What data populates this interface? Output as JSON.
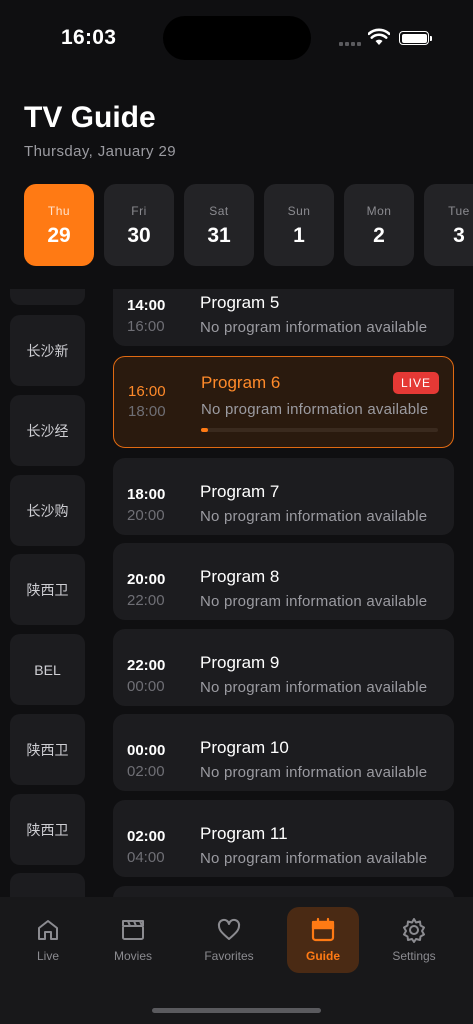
{
  "status": {
    "time": "16:03"
  },
  "header": {
    "title": "TV Guide",
    "date": "Thursday, January 29"
  },
  "days": [
    {
      "name": "Thu",
      "num": "29",
      "active": true
    },
    {
      "name": "Fri",
      "num": "30"
    },
    {
      "name": "Sat",
      "num": "31"
    },
    {
      "name": "Sun",
      "num": "1"
    },
    {
      "name": "Mon",
      "num": "2"
    },
    {
      "name": "Tue",
      "num": "3"
    }
  ],
  "channels": [
    "",
    "长沙新",
    "长沙经",
    "长沙购",
    "陕西卫",
    "BEL",
    "陕西卫",
    "陕西卫",
    ""
  ],
  "programs": [
    {
      "start": "14:00",
      "end": "16:00",
      "name": "Program 5",
      "desc": "No program information available"
    },
    {
      "start": "16:00",
      "end": "18:00",
      "name": "Program 6",
      "desc": "No program information available",
      "live": true,
      "badge": "LIVE",
      "progress": 0.03
    },
    {
      "start": "18:00",
      "end": "20:00",
      "name": "Program 7",
      "desc": "No program information available"
    },
    {
      "start": "20:00",
      "end": "22:00",
      "name": "Program 8",
      "desc": "No program information available"
    },
    {
      "start": "22:00",
      "end": "00:00",
      "name": "Program 9",
      "desc": "No program information available"
    },
    {
      "start": "00:00",
      "end": "02:00",
      "name": "Program 10",
      "desc": "No program information available"
    },
    {
      "start": "02:00",
      "end": "04:00",
      "name": "Program 11",
      "desc": "No program information available"
    },
    {
      "start": "",
      "end": "",
      "name": "",
      "desc": ""
    }
  ],
  "tabs": [
    {
      "label": "Live",
      "icon": "home-icon"
    },
    {
      "label": "Movies",
      "icon": "clapperboard-icon"
    },
    {
      "label": "Favorites",
      "icon": "heart-icon"
    },
    {
      "label": "Guide",
      "icon": "calendar-icon",
      "active": true
    },
    {
      "label": "Settings",
      "icon": "gear-icon"
    }
  ],
  "colors": {
    "accent": "#ff7a14",
    "live": "#e53935",
    "background": "#0f0f11",
    "card": "#1c1c1f"
  }
}
